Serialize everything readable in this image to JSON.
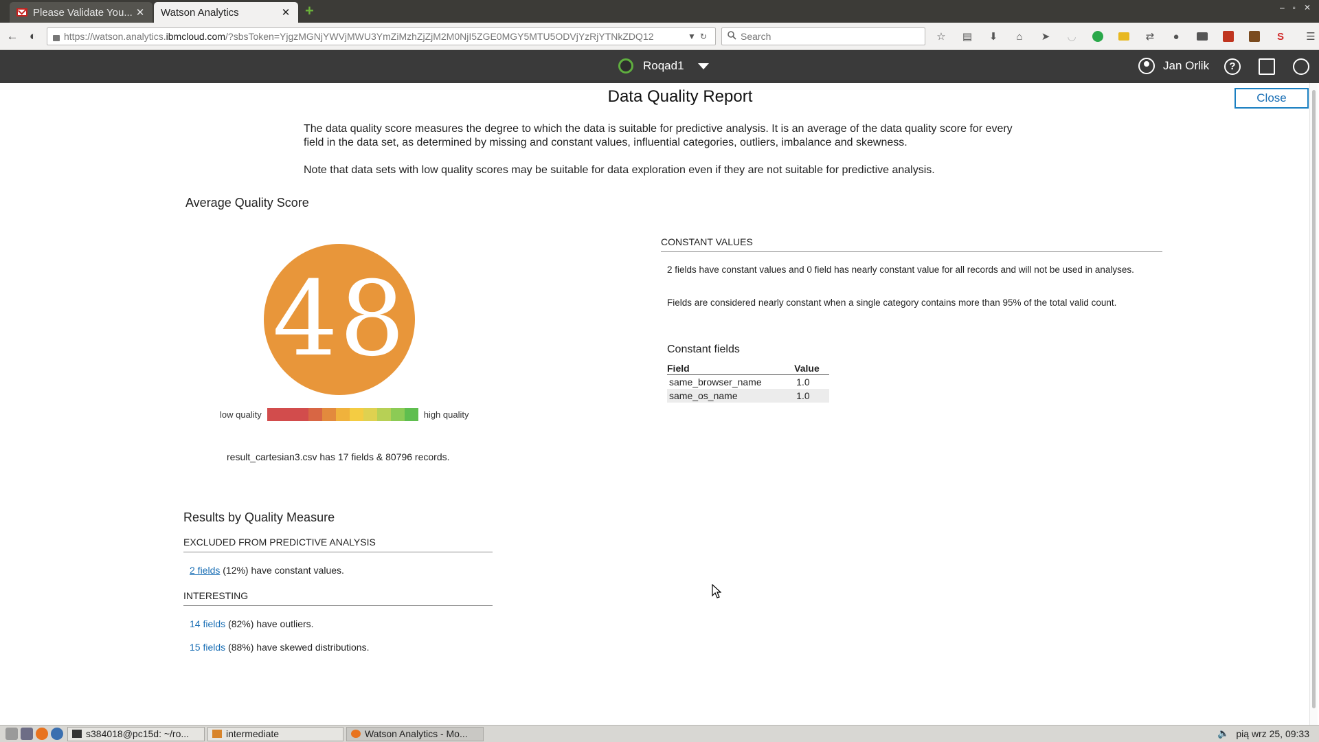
{
  "browser": {
    "tabs": [
      {
        "label": "Please Validate You...",
        "active": false
      },
      {
        "label": "Watson Analytics",
        "active": true
      }
    ],
    "url_prefix": "https://watson.analytics.",
    "url_domain": "ibmcloud.com",
    "url_rest": "/?sbsToken=YjgzMGNjYWVjMWU3YmZiMzhZjZjM2M0NjI5ZGE0MGY5MTU5ODVjYzRjYTNkZDQ12",
    "search_placeholder": "Search"
  },
  "app": {
    "project_name": "Roqad1",
    "user_name": "Jan Orlik"
  },
  "report": {
    "title": "Data Quality Report",
    "close_label": "Close",
    "intro_p1": "The data quality score measures the degree to which the data is suitable for predictive analysis. It is an average of the data quality score for every field in the data set, as determined by missing and constant values, influential categories, outliers, imbalance and skewness.",
    "intro_p2": "Note that data sets with low quality scores may be suitable for data exploration even if they are not suitable for predictive analysis.",
    "avg_title": "Average Quality Score",
    "score": "48",
    "scale_low": "low quality",
    "scale_high": "high quality",
    "scale_colors": [
      "#d24c4c",
      "#d24c4c",
      "#d24c4c",
      "#d86644",
      "#e38a3d",
      "#f0b23c",
      "#f4cc42",
      "#dfd150",
      "#b7d055",
      "#8ccb55",
      "#5fbe4f"
    ],
    "records_text": "result_cartesian3.csv has 17 fields & 80796 records.",
    "constant": {
      "heading": "CONSTANT VALUES",
      "p1": "2 fields have constant values and 0 field has nearly constant value for all records and will not be used in analyses.",
      "p2": "Fields are considered nearly constant when a single category contains more than 95% of the total valid count.",
      "subtitle": "Constant fields",
      "columns": [
        "Field",
        "Value"
      ],
      "rows": [
        {
          "field": "same_browser_name",
          "value": "1.0"
        },
        {
          "field": "same_os_name",
          "value": "1.0"
        }
      ]
    },
    "results": {
      "title": "Results by Quality Measure",
      "excluded_heading": "EXCLUDED FROM PREDICTIVE ANALYSIS",
      "excluded_link": "2 fields",
      "excluded_text": " (12%) have constant values.",
      "interesting_heading": "INTERESTING",
      "outliers_link": "14 fields",
      "outliers_text": " (82%) have outliers.",
      "skewed_link": "15 fields",
      "skewed_text": " (88%) have skewed distributions."
    }
  },
  "taskbar": {
    "tasks": [
      {
        "label": "s384018@pc15d: ~/ro..."
      },
      {
        "label": "intermediate"
      },
      {
        "label": "Watson Analytics - Mo..."
      }
    ],
    "clock": "pią wrz 25, 09:33"
  }
}
